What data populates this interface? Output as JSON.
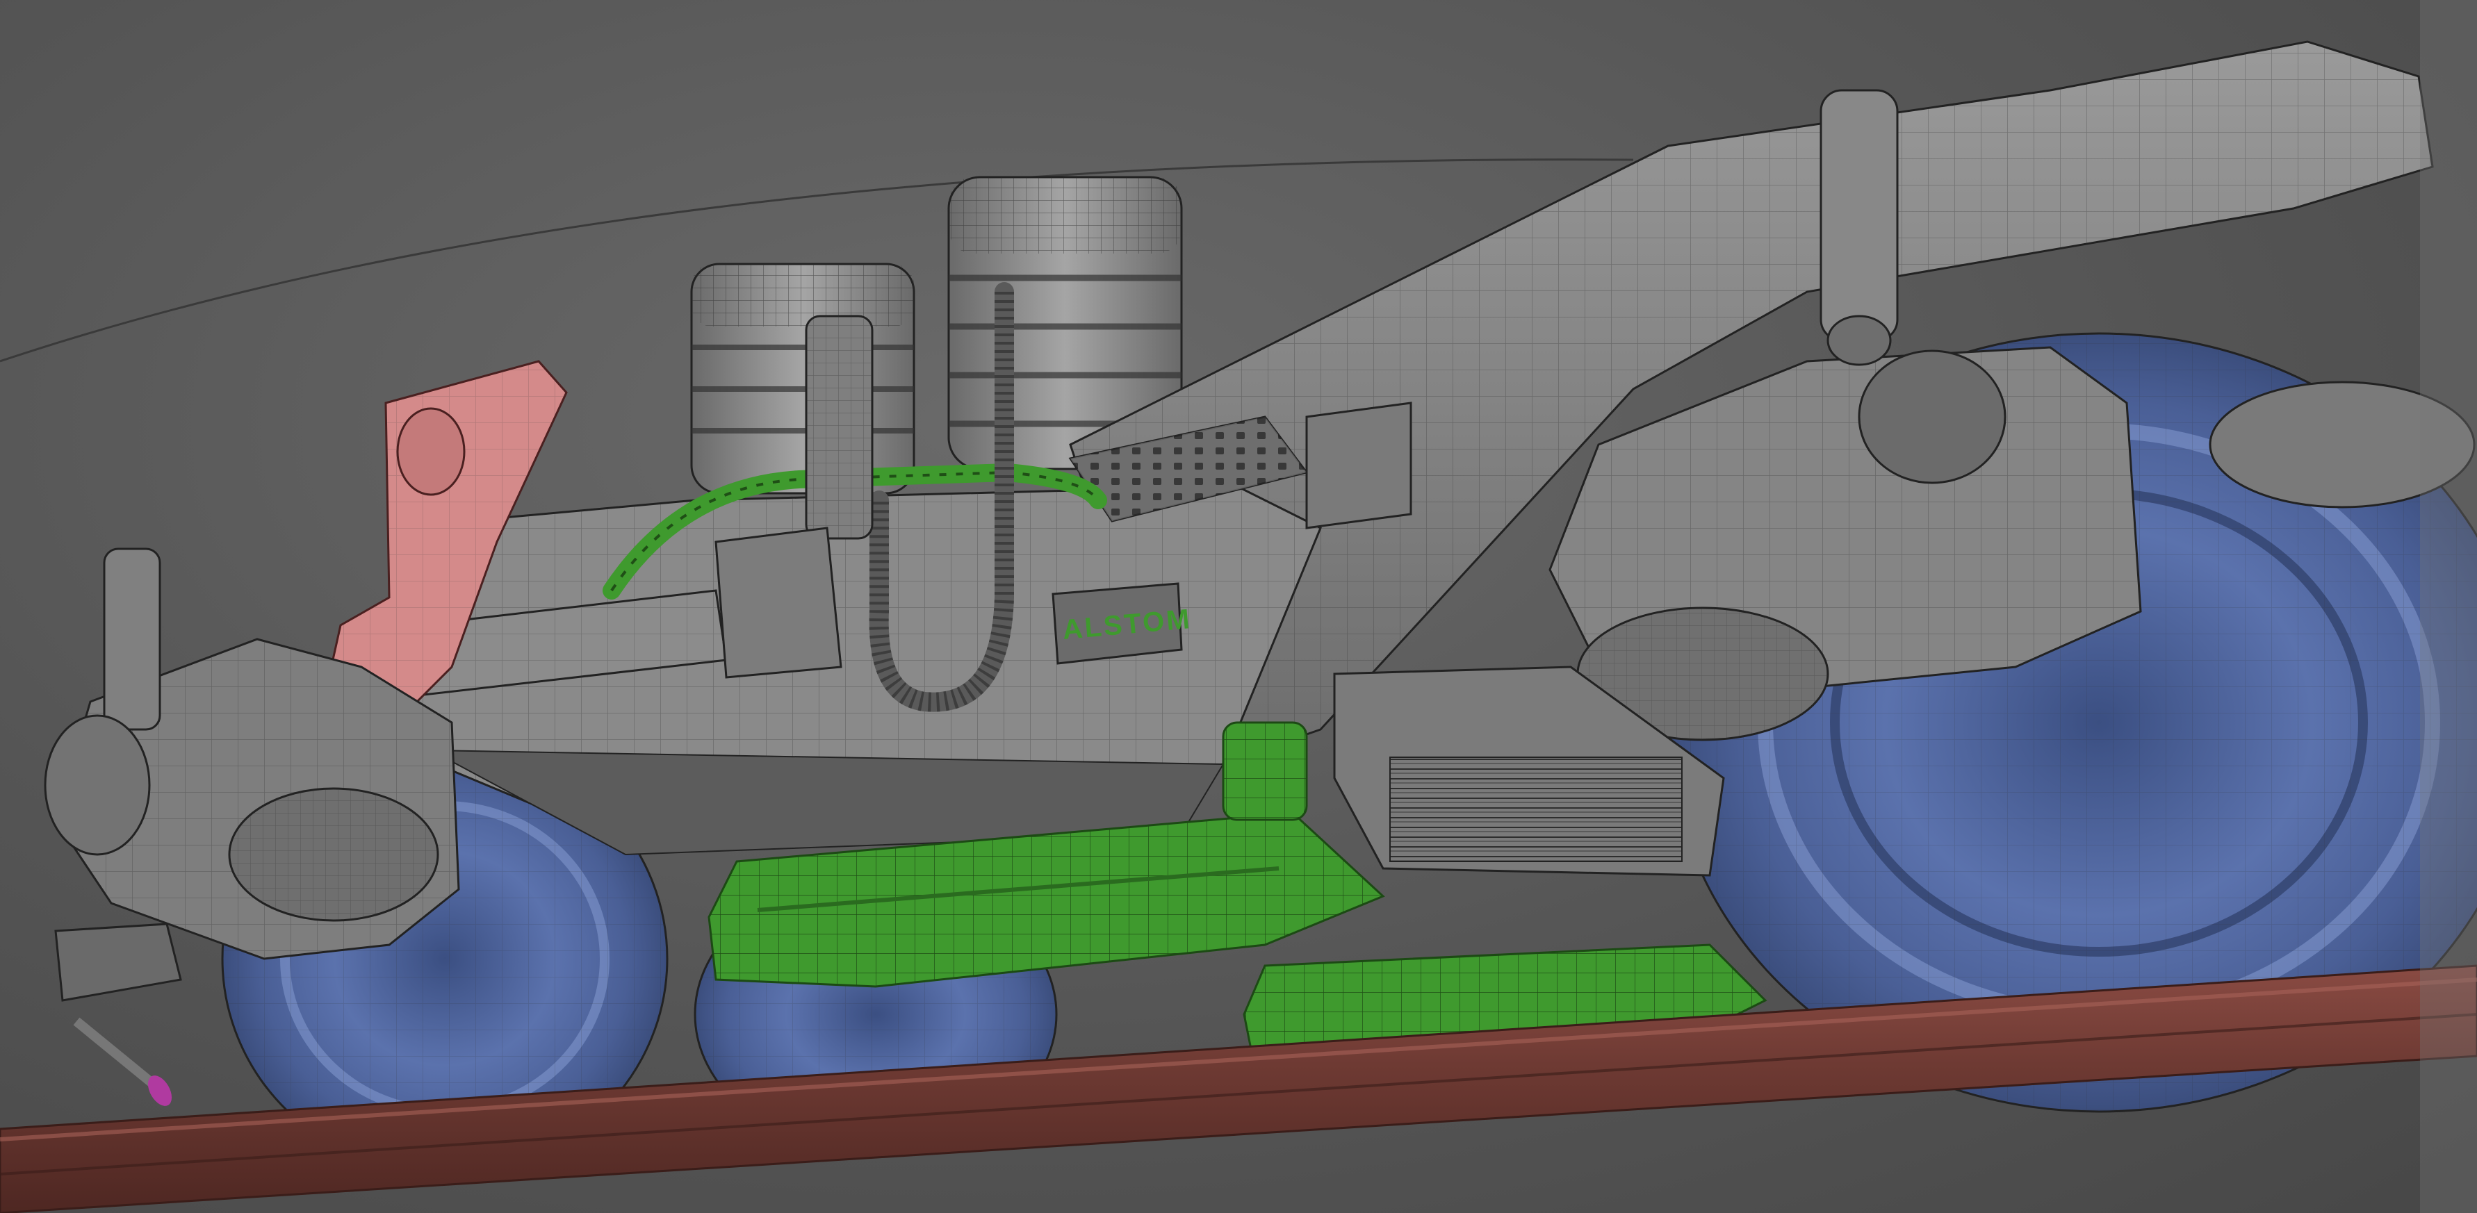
{
  "scene": {
    "description_label": "",
    "nameplate_text": "ALSTOM"
  },
  "materials": {
    "background": "#5a5a5a",
    "frame_gray": "#8c8c8c",
    "frame_dark": "#5f5f5f",
    "wireframe": "#2a2a2a",
    "wheel_blue": "#4a5f96",
    "wheel_blue_light": "#6f86bf",
    "green_part": "#3f9a2e",
    "green_dark": "#2a6b1f",
    "pink_part": "#d48a8a",
    "rail_brown": "#6e3a33",
    "rail_brown_light": "#8a4b43",
    "purple_tip": "#b03aa0"
  },
  "objects": [
    {
      "id": "bogie-frame",
      "icon": "frame-icon"
    },
    {
      "id": "air-spring-left",
      "icon": "spring-icon"
    },
    {
      "id": "air-spring-right",
      "icon": "spring-icon"
    },
    {
      "id": "wheel-front-left",
      "icon": "wheel-icon"
    },
    {
      "id": "wheel-front-right",
      "icon": "wheel-icon"
    },
    {
      "id": "wheel-rear-large",
      "icon": "wheel-icon"
    },
    {
      "id": "traction-link",
      "icon": "link-icon"
    },
    {
      "id": "green-bracket",
      "icon": "bracket-icon"
    },
    {
      "id": "axle-box",
      "icon": "axlebox-icon"
    },
    {
      "id": "rail",
      "icon": "rail-icon"
    }
  ]
}
